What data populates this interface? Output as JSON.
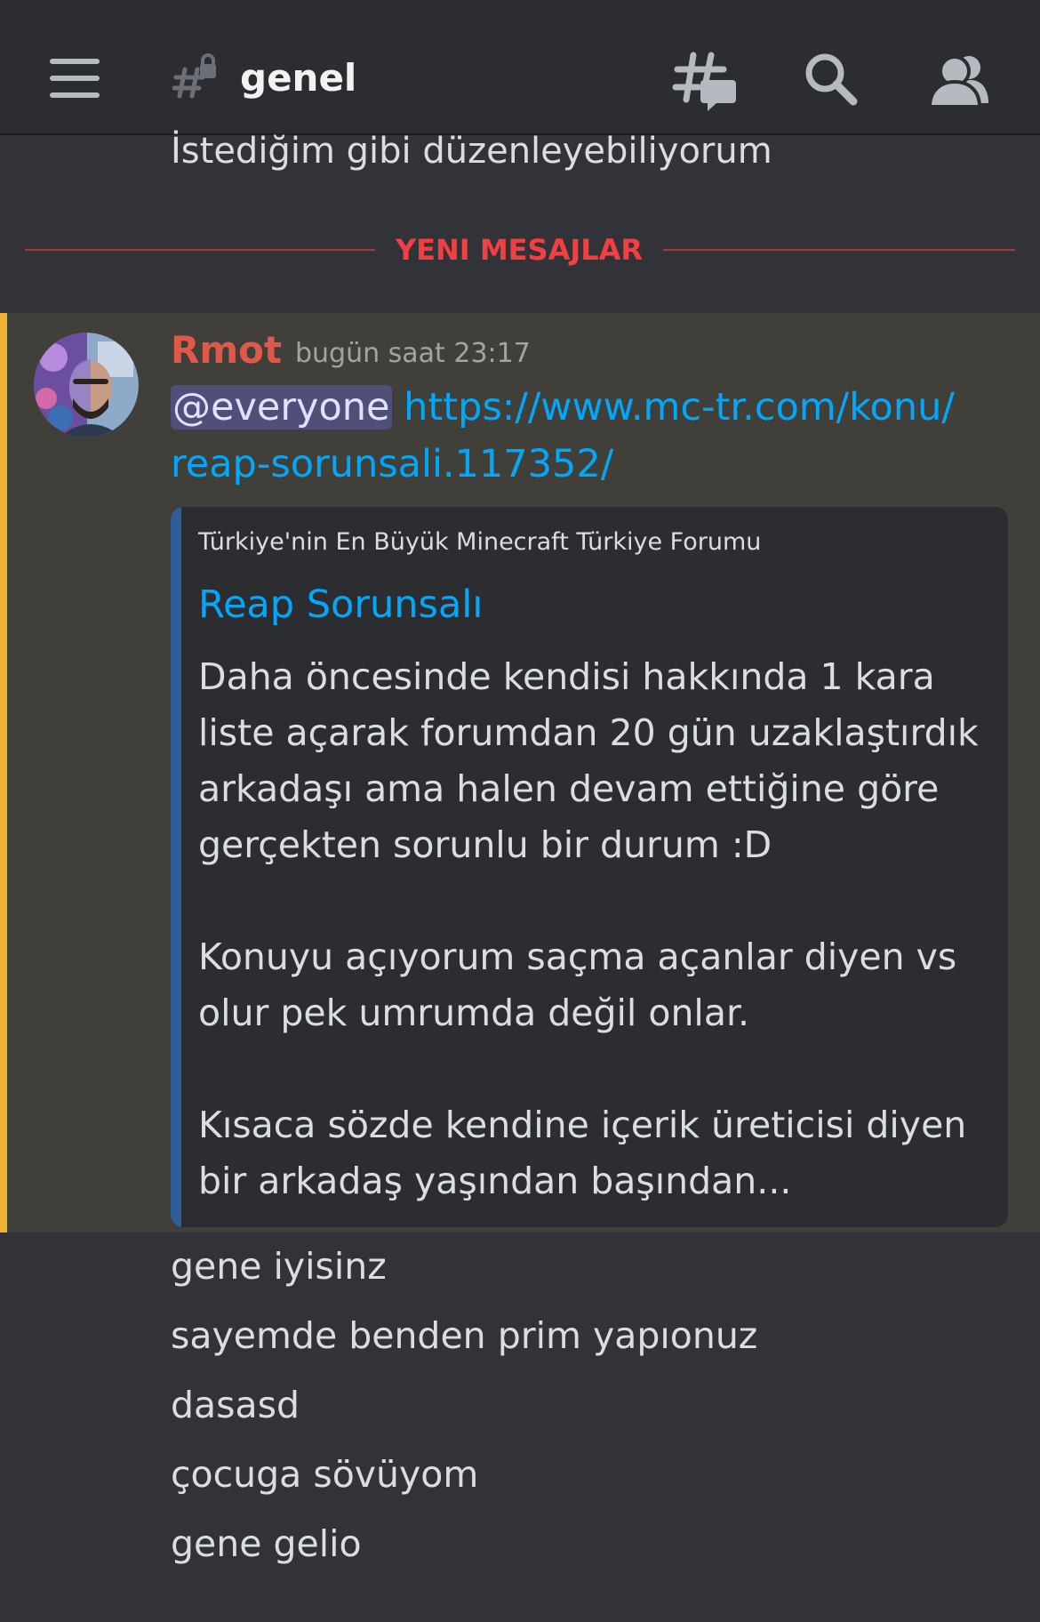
{
  "header": {
    "channel_name": "genel"
  },
  "previous_message": "İstediğim gibi düzenleyebiliyorum",
  "new_messages_divider": "YENI MESAJLAR",
  "message": {
    "author": "Rmot",
    "timestamp": "bugün saat 23:17",
    "mention": "@everyone",
    "link_part1": "https://www.mc-tr.com/konu/",
    "link_part2": "reap-sorunsali.117352/"
  },
  "embed": {
    "provider": "Türkiye'nin En Büyük Minecraft Türkiye Forumu",
    "title": "Reap Sorunsalı",
    "description_lines": [
      "Daha öncesinde kendisi hakkında 1 kara",
      "liste açarak forumdan 20 gün uzaklaştırdık",
      "arkadaşı ama halen devam ettiğine göre",
      "gerçekten sorunlu bir durum :D",
      "Konuyu açıyorum saçma açanlar diyen vs",
      "olur pek umrumda değil onlar.",
      "Kısaca sözde kendine içerik üreticisi diyen",
      "bir arkadaş yaşından başından..."
    ]
  },
  "followup_messages": [
    "gene iyisinz",
    "sayemde benden prim yapıonuz",
    "dasasd",
    "çocuga sövüyom",
    "gene gelio"
  ],
  "icons": {
    "menu": "hamburger-menu-icon",
    "channel": "locked-channel-hash-icon",
    "threads": "threads-icon",
    "search": "search-icon",
    "members": "members-icon"
  },
  "colors": {
    "background": "#313338",
    "header_bg": "#2b2d31",
    "highlight_bg": "#413f39",
    "highlight_bar": "#f0b232",
    "username": "#e0584a",
    "link": "#00a8fc",
    "divider_red": "#f23f43",
    "embed_bar": "#2d5e9a",
    "mention_bg": "#4f4f7a"
  }
}
